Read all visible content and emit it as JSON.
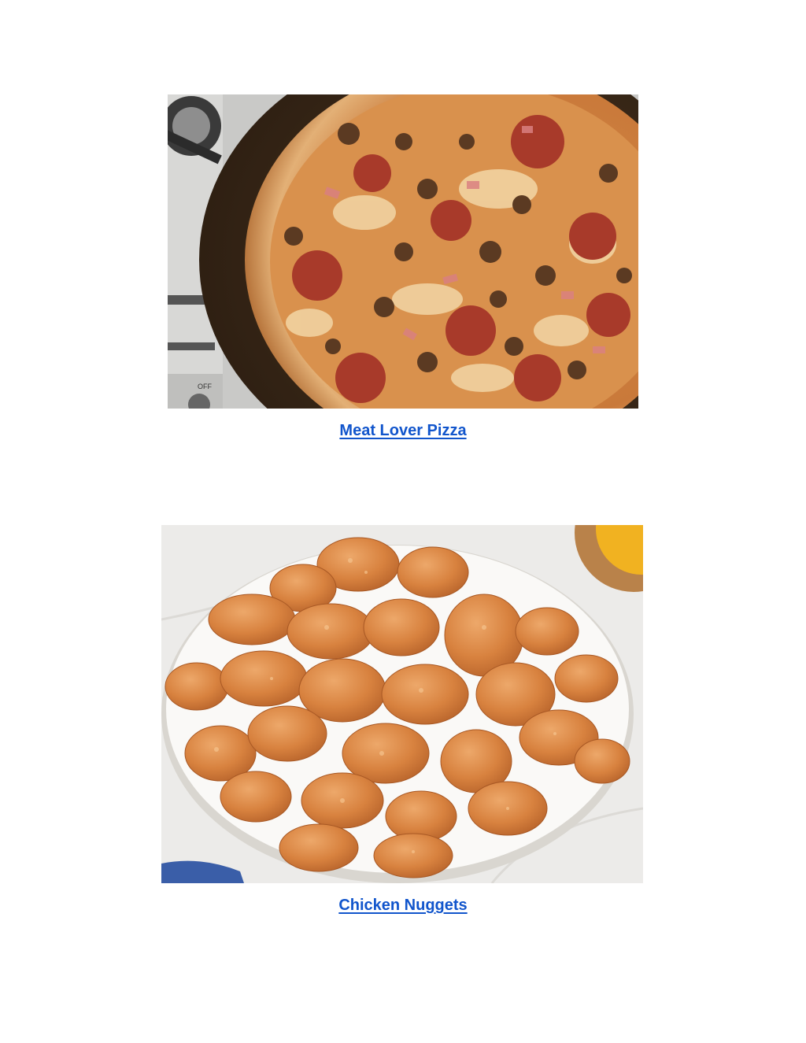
{
  "colors": {
    "link": "#1155cc",
    "page_background": "#ffffff"
  },
  "items": [
    {
      "caption": "Meat Lover Pizza",
      "image": "meat-lover-pizza-photo"
    },
    {
      "caption": "Chicken Nuggets",
      "image": "chicken-nuggets-photo"
    }
  ]
}
